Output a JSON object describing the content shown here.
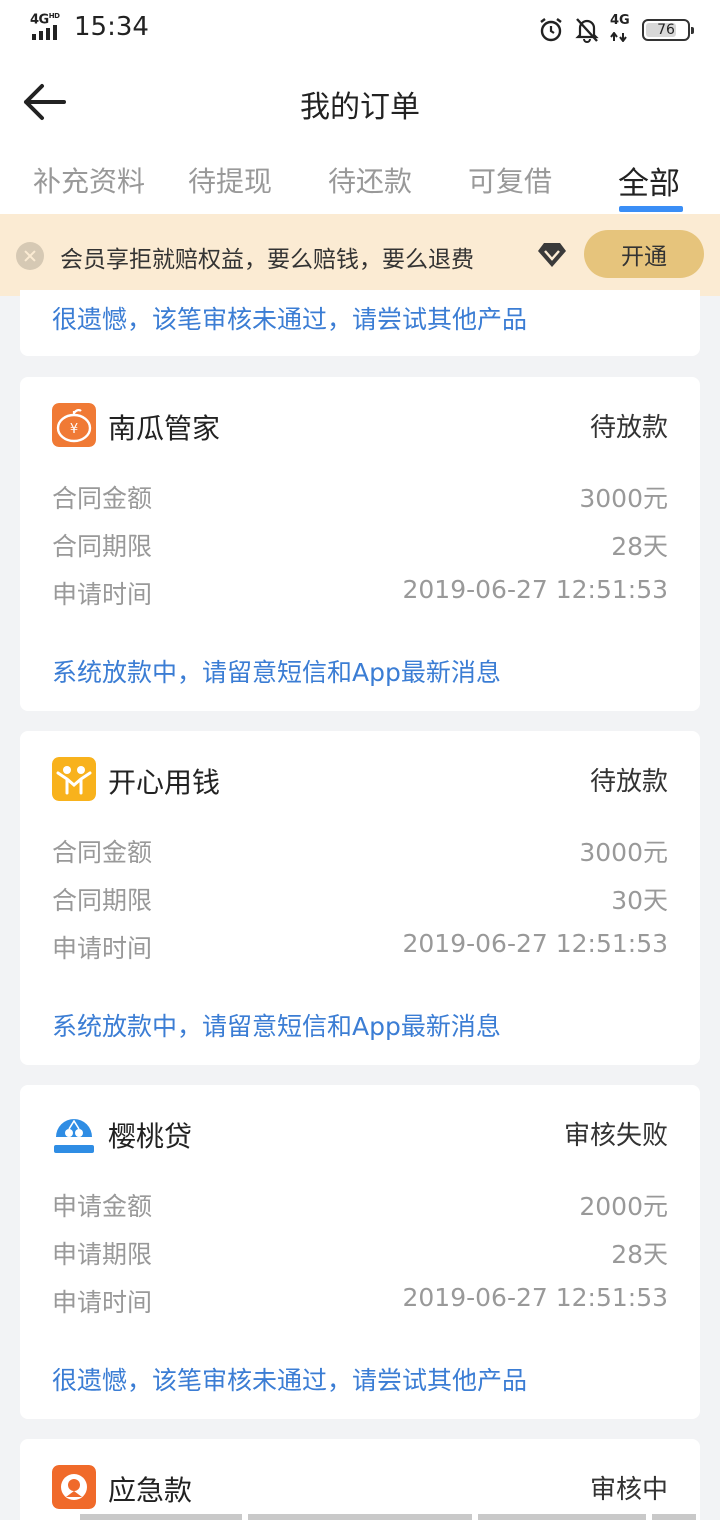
{
  "statusbar": {
    "network": "4G",
    "network_sup": "HD",
    "time": "15:34",
    "net_small": "4G",
    "battery": "76",
    "battery_level": 0.76
  },
  "header": {
    "title": "我的订单"
  },
  "tabs": [
    {
      "label": "补充资料",
      "active": false
    },
    {
      "label": "待提现",
      "active": false
    },
    {
      "label": "待还款",
      "active": false
    },
    {
      "label": "可复借",
      "active": false
    },
    {
      "label": "全部",
      "active": true
    }
  ],
  "banner": {
    "text": "会员享拒就赔权益，要么赔钱，要么退费",
    "button": "开通"
  },
  "partial_card": {
    "message": "很遗憾，该笔审核未通过，请尝试其他产品"
  },
  "orders": [
    {
      "name": "南瓜管家",
      "status": "待放款",
      "logo_color": "#f07a35",
      "rows": [
        {
          "label": "合同金额",
          "value": "3000元"
        },
        {
          "label": "合同期限",
          "value": "28天"
        },
        {
          "label": "申请时间",
          "value": "2019-06-27 12:51:53"
        }
      ],
      "message": "系统放款中，请留意短信和App最新消息"
    },
    {
      "name": "开心用钱",
      "status": "待放款",
      "logo_color": "#f8b21c",
      "rows": [
        {
          "label": "合同金额",
          "value": "3000元"
        },
        {
          "label": "合同期限",
          "value": "30天"
        },
        {
          "label": "申请时间",
          "value": "2019-06-27 12:51:53"
        }
      ],
      "message": "系统放款中，请留意短信和App最新消息"
    },
    {
      "name": "樱桃贷",
      "status": "审核失败",
      "logo_color": "#2f8de4",
      "rows": [
        {
          "label": "申请金额",
          "value": "2000元"
        },
        {
          "label": "申请期限",
          "value": "28天"
        },
        {
          "label": "申请时间",
          "value": "2019-06-27 12:51:53"
        }
      ],
      "message": "很遗憾，该笔审核未通过，请尝试其他产品"
    },
    {
      "name": "应急款",
      "status": "审核中",
      "logo_color": "#f06a2a",
      "rows": [],
      "message": ""
    }
  ],
  "colors": {
    "accent": "#3a8ef6",
    "link_text": "#3b7dd4",
    "banner_bg": "#fbebd3",
    "banner_button": "#e6c47c"
  }
}
